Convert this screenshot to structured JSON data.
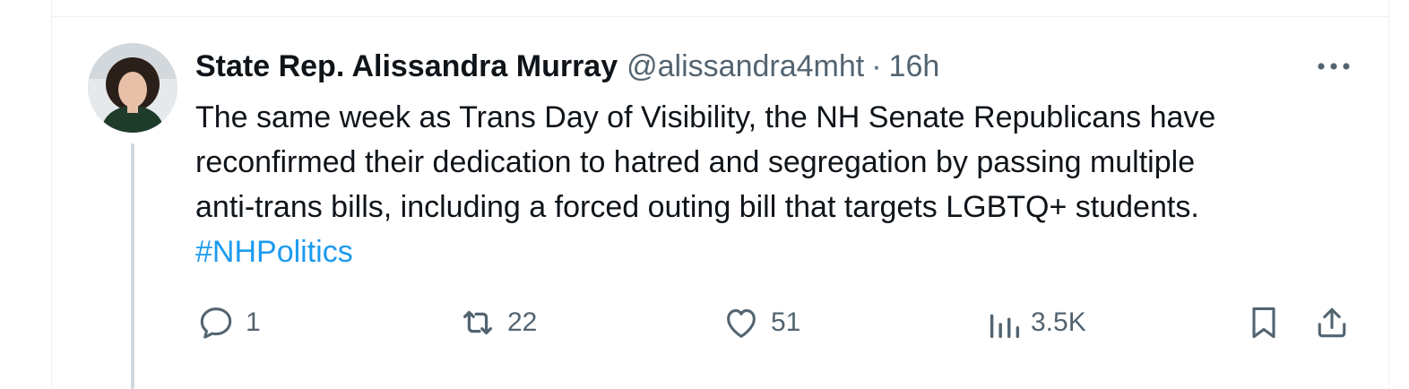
{
  "tweet": {
    "display_name": "State Rep. Alissandra Murray",
    "handle": "@alissandra4mht",
    "separator": "·",
    "time": "16h",
    "text_lines": [
      "The same week as Trans Day of Visibility, the NH Senate Republicans have",
      "reconfirmed their dedication to hatred and segregation by passing multiple",
      "anti-trans bills, including a forced outing bill that targets LGBTQ+ students."
    ],
    "hashtag": "#NHPolitics"
  },
  "actions": {
    "replies": "1",
    "reposts": "22",
    "likes": "51",
    "views": "3.5K"
  },
  "colors": {
    "text": "#0f1419",
    "secondary": "#536471",
    "accent": "#1d9bf0",
    "thread_line": "#cfd9de"
  }
}
